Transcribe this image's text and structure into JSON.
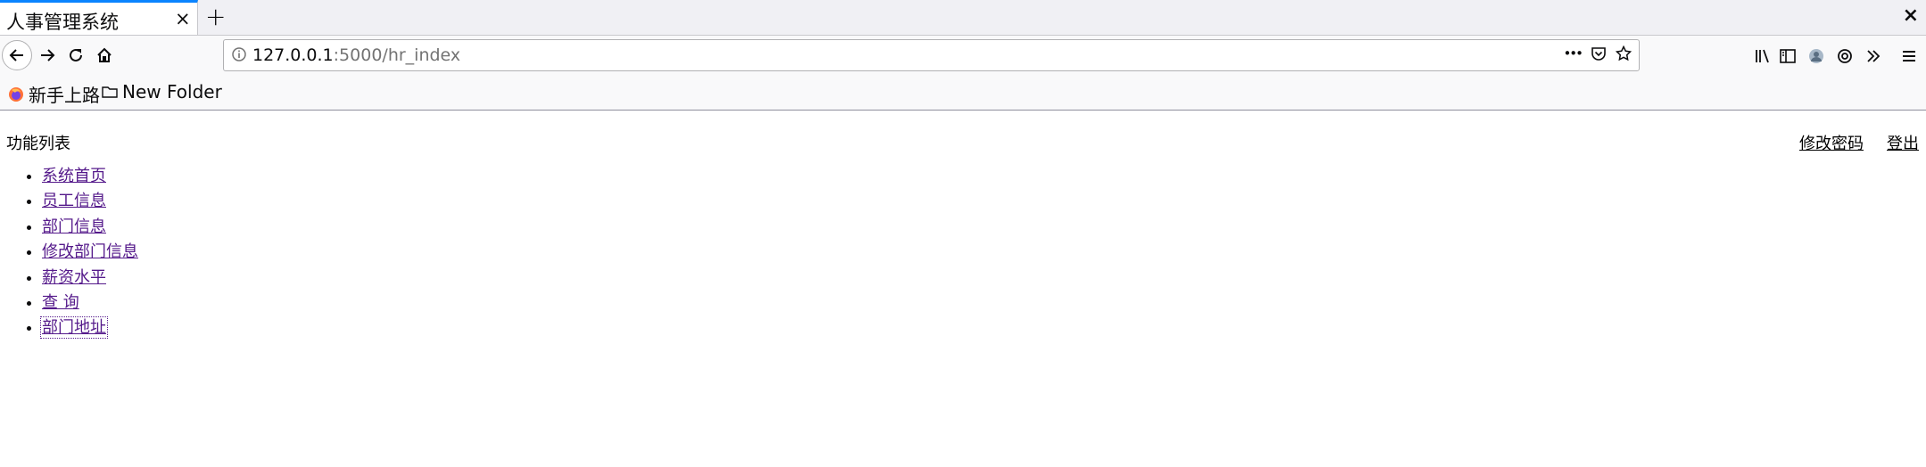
{
  "tab": {
    "title": "人事管理系统",
    "close": "×"
  },
  "newtab": "+",
  "window_close": "×",
  "url": {
    "host": "127.0.0.1",
    "rest": ":5000/hr_index"
  },
  "url_actions": {
    "more": "•••"
  },
  "bookmarks": [
    {
      "label": "新手上路",
      "icon": "firefox-icon"
    },
    {
      "label": "New Folder",
      "icon": "folder-icon"
    }
  ],
  "page": {
    "section_title": "功能列表",
    "top_links": {
      "change_password": "修改密码",
      "logout": "登出"
    },
    "menu": [
      "系统首页",
      "员工信息",
      "部门信息",
      "修改部门信息",
      "薪资水平",
      "查 询",
      "部门地址"
    ]
  },
  "colors": {
    "accent": "#0a84ff",
    "visited_link": "#551a8b"
  }
}
